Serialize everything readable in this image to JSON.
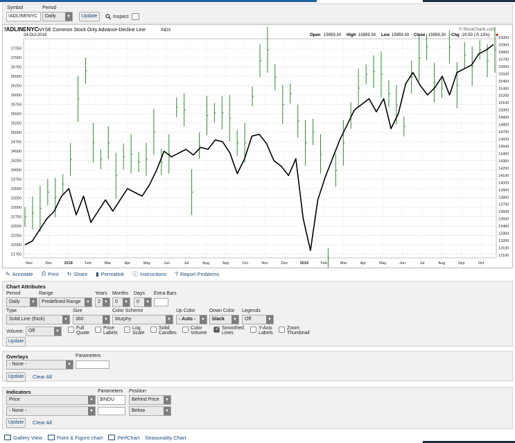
{
  "form": {
    "symbol_label": "Symbol",
    "symbol_value": "!ADLINENYC",
    "period_label": "Period",
    "period_value": "Daily",
    "update_label": "Update",
    "inspect_label": "Inspect"
  },
  "chart": {
    "symbol": "!ADLINENYC",
    "description": "NYSE Common Stock Only Advance-Decline Line",
    "exchange": "INDX",
    "date": "24-Oct-2019",
    "watermark": "© StockCharts.com",
    "ohlc_text": {
      "open_label": "Open",
      "open": "15959.30",
      "high_label": "High",
      "high": "15959.30",
      "low_label": "Low",
      "low": "15959.30",
      "close_label": "Close",
      "close": "15959.30",
      "chg_label": "Chg",
      "chg": "-20.50 (-0.13%)"
    },
    "colors": {
      "price_bars": "#2e8b2e",
      "overlay_line": "#000000",
      "chg_arrow": "#cc0000"
    }
  },
  "chart_data": {
    "type": "line",
    "left_axis": {
      "ticks": [
        "27250",
        "27000",
        "26750",
        "26500",
        "26250",
        "26000",
        "25750",
        "25500",
        "25250",
        "25000",
        "24750",
        "24500",
        "24250",
        "24000",
        "23750",
        "23500",
        "23250",
        "23000",
        "22750",
        "22500",
        "22250",
        "22000",
        "21750"
      ],
      "range": [
        21650,
        27500
      ]
    },
    "right_axis": {
      "ticks": [
        "16000",
        "15900",
        "15800",
        "15700",
        "15600",
        "15500",
        "15400",
        "15300",
        "15200",
        "15100",
        "15000",
        "14900",
        "14800",
        "14700",
        "14600",
        "14500",
        "14400",
        "14300",
        "14200",
        "14100",
        "14000",
        "13900",
        "13800",
        "13700",
        "13600",
        "13500",
        "13400",
        "13300",
        "13200",
        "13100",
        "12100"
      ]
    },
    "x_labels": [
      "Nov",
      "Dec",
      "2018",
      "Feb",
      "Mar",
      "Apr",
      "May",
      "Jun",
      "Jul",
      "Aug",
      "Sep",
      "Oct",
      "Nov",
      "Dec",
      "2019",
      "Feb",
      "Mar",
      "Apr",
      "May",
      "Jun",
      "Jul",
      "Aug",
      "Sep",
      "Oct"
    ],
    "x_bold": [
      "2018",
      "2019"
    ],
    "series": [
      {
        "style": "green-hlc-bars",
        "values": [
          12750,
          12820,
          12900,
          13200,
          13100,
          13350,
          13800,
          14900,
          15420,
          14100,
          13800,
          14100,
          13500,
          13850,
          13900,
          13750,
          13800,
          14300,
          13750,
          13900,
          14750,
          14700,
          13200,
          14050,
          14600,
          14650,
          14650,
          14550,
          14100,
          14100,
          14950,
          15600,
          15800,
          15300,
          14800,
          15000,
          14500,
          14100,
          14300,
          13900,
          12000,
          13600,
          14100,
          14600,
          15100,
          15350,
          15400,
          15350,
          15000,
          14800,
          14400,
          15300,
          15650,
          15850,
          15200,
          15100,
          15850,
          15150,
          15700,
          15500,
          15800,
          15600,
          15800
        ]
      },
      {
        "style": "black-line",
        "values": [
          22000,
          22100,
          22400,
          22700,
          22900,
          23300,
          23500,
          22800,
          23300,
          22600,
          22900,
          23200,
          22900,
          23200,
          23500,
          23400,
          23300,
          23600,
          24000,
          24500,
          24350,
          24450,
          24550,
          24400,
          24600,
          24550,
          24800,
          24750,
          24450,
          23900,
          24300,
          24900,
          24950,
          24700,
          24250,
          24100,
          23850,
          24300,
          22700,
          21850,
          23200,
          23800,
          24300,
          24800,
          25200,
          25600,
          25750,
          25900,
          25550,
          25900,
          25100,
          25500,
          26300,
          26600,
          26250,
          26000,
          26200,
          26500,
          26000,
          26600,
          26700,
          26800,
          27100,
          27200,
          27350
        ]
      }
    ]
  },
  "toolbar": {
    "annotate": "Annotate",
    "print": "Print",
    "share": "Share",
    "permalink": "Permalink",
    "instructions": "Instructions",
    "report": "Report Problems"
  },
  "attributes": {
    "title": "Chart Attributes",
    "period_label": "Period",
    "period_value": "Daily",
    "range_label": "Range",
    "range_value": "Predefined Range",
    "years_label": "Years",
    "years_value": "2",
    "months_label": "Months",
    "months_value": "0",
    "days_label": "Days",
    "days_value": "0",
    "extra_bars_label": "Extra Bars",
    "type_label": "Type",
    "type_value": "Solid Line (thick)",
    "size_label": "Size",
    "size_value": "360",
    "color_scheme_label": "Color Scheme",
    "color_scheme_value": "Murphy",
    "up_color_label": "Up Color",
    "up_color_value": "- Auto -",
    "down_color_label": "Down Color",
    "down_color_value": "black",
    "legends_label": "Legends",
    "legends_value": "Off",
    "volume_label": "Volume:",
    "volume_value": "Off",
    "full_quote": [
      "Full",
      "Quote"
    ],
    "price_labels": [
      "Price",
      "Labels"
    ],
    "log_scale": [
      "Log",
      "Scale"
    ],
    "solid_candles": [
      "Solid",
      "Candles"
    ],
    "color_volume": [
      "Color",
      "Volume"
    ],
    "smoothed_lines": [
      "Smoothed",
      "Lines"
    ],
    "yaxis_labels": [
      "Y-Axis",
      "Labels"
    ],
    "zoom_thumbnail": [
      "Zoom",
      "Thumbnail"
    ],
    "update_label": "Update"
  },
  "overlays": {
    "title": "Overlays",
    "parameters_label": "Parameters",
    "overlay_value": "- None -",
    "update_label": "Update",
    "clear_label": "Clear All"
  },
  "indicators": {
    "title": "Indicators",
    "parameters_label": "Parameters",
    "position_label": "Position",
    "row1_indicator": "Price",
    "row1_param": "$INDU",
    "row1_position": "Behind Price",
    "row2_indicator": "- None -",
    "row2_position": "Below",
    "update_label": "Update",
    "clear_label": "Clear All"
  },
  "bottom_links": {
    "gallery": "Gallery View",
    "pnf": "Point & Figure chart",
    "perf": "PerfChart",
    "seasonality": "Seasonality Chart"
  }
}
